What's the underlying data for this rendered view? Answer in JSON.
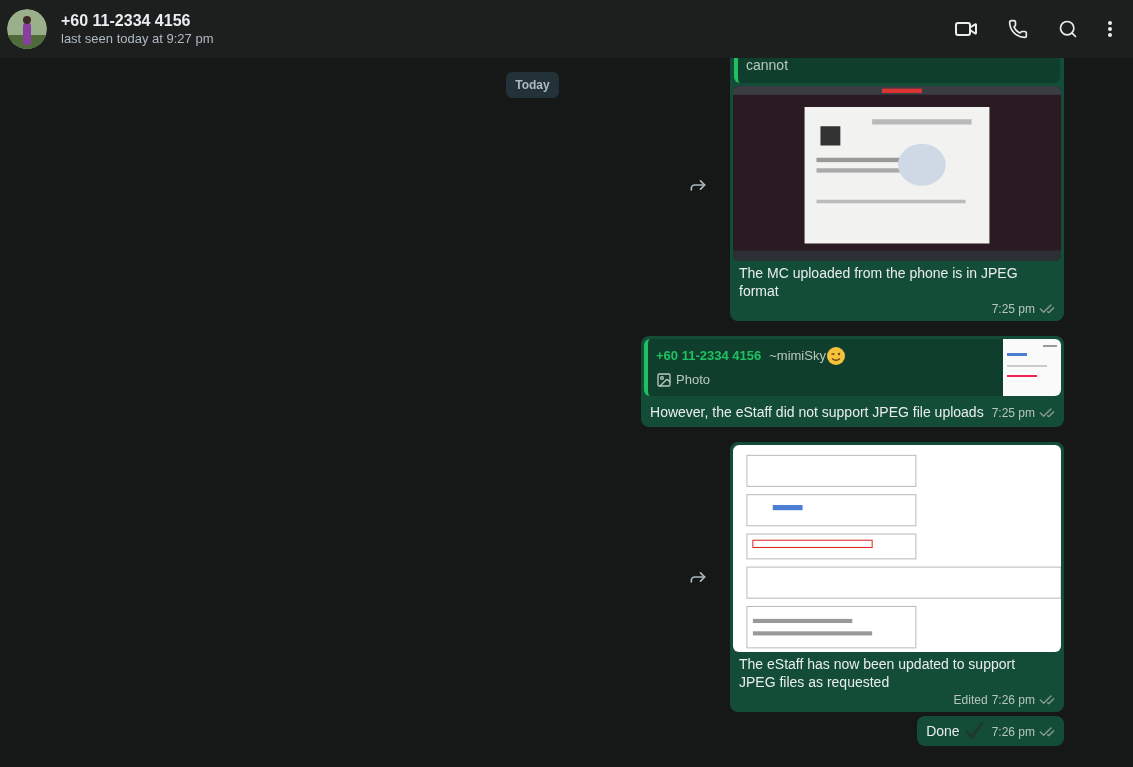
{
  "header": {
    "name": "+60 11-2334 4156",
    "status": "last seen today at 9:27 pm"
  },
  "date_chip": "Today",
  "messages": [
    {
      "forwarded": true,
      "quote": {
        "text": "cannot"
      },
      "caption": "The MC uploaded from the phone is in JPEG format",
      "time": "7:25 pm"
    },
    {
      "kind": "reply",
      "forwarded": false,
      "quote": {
        "author": "+60 11-2334 4156",
        "nickname": "~mimiSky",
        "media": "Photo"
      },
      "text": "However, the eStaff did not support JPEG file uploads",
      "time": "7:25 pm"
    },
    {
      "forwarded": true,
      "caption": "The eStaff has now been updated to support JPEG files as requested",
      "edited_label": "Edited",
      "time": "7:26 pm"
    },
    {
      "kind": "text",
      "forwarded": false,
      "text": "Done",
      "time": "7:26 pm",
      "emoji_check": true
    }
  ]
}
